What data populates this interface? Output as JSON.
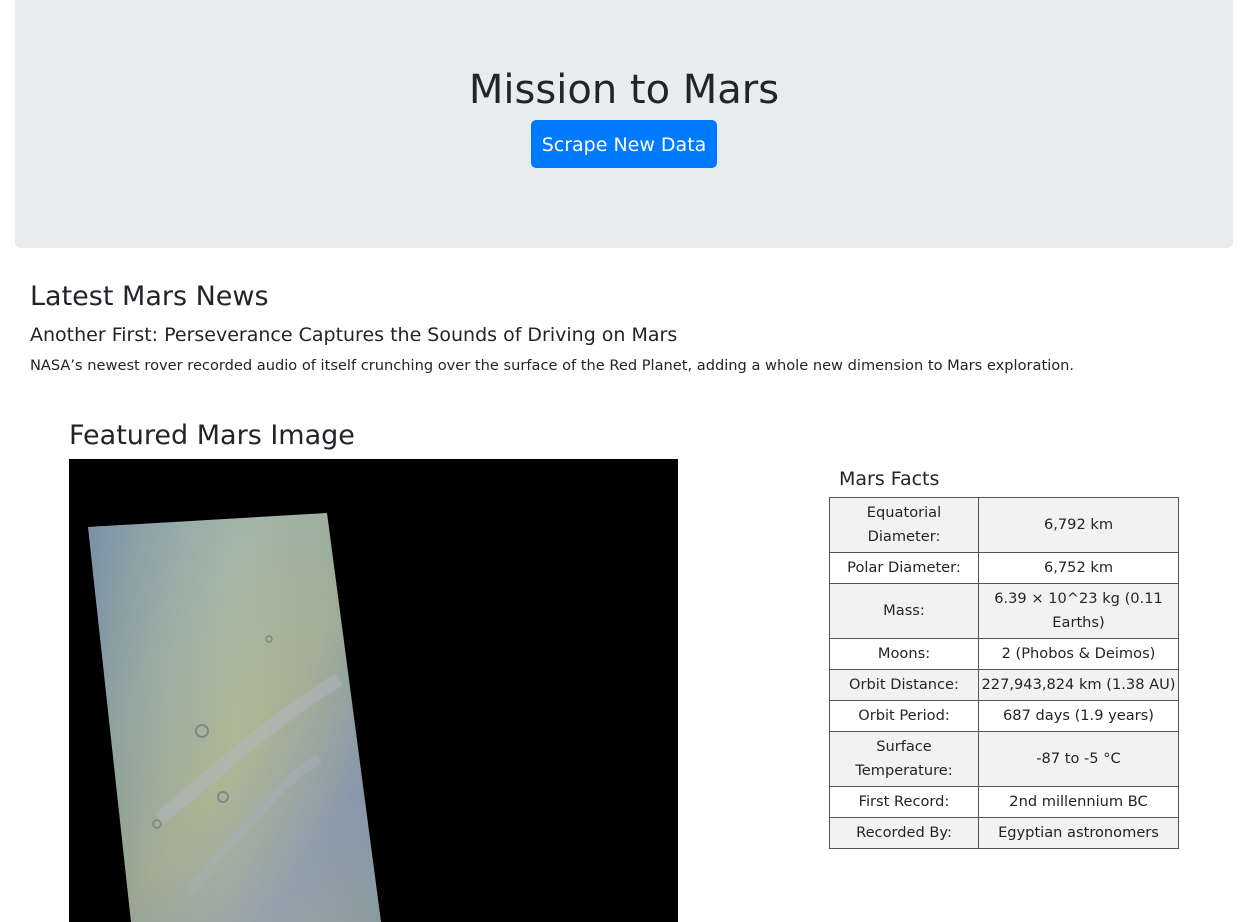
{
  "header": {
    "title": "Mission to Mars",
    "scrape_button": "Scrape New Data",
    "background_color": "#e9ecef",
    "button_color": "#007bff"
  },
  "news": {
    "heading": "Latest Mars News",
    "title": "Another First: Perseverance Captures the Sounds of Driving on Mars",
    "paragraph": "NASA’s newest rover recorded audio of itself crunching over the surface of the Red Planet, adding a whole new dimension to Mars exploration."
  },
  "featured_image": {
    "heading": "Featured Mars Image"
  },
  "facts": {
    "heading": "Mars Facts",
    "rows": [
      {
        "label": "Equatorial Diameter:",
        "value": "6,792 km"
      },
      {
        "label": "Polar Diameter:",
        "value": "6,752 km"
      },
      {
        "label": "Mass:",
        "value": "6.39 × 10^23 kg (0.11 Earths)"
      },
      {
        "label": "Moons:",
        "value": "2 (Phobos & Deimos)"
      },
      {
        "label": "Orbit Distance:",
        "value": "227,943,824 km (1.38 AU)"
      },
      {
        "label": "Orbit Period:",
        "value": "687 days (1.9 years)"
      },
      {
        "label": "Surface Temperature:",
        "value": "-87 to -5 °C"
      },
      {
        "label": "First Record:",
        "value": "2nd millennium BC"
      },
      {
        "label": "Recorded By:",
        "value": "Egyptian astronomers"
      }
    ]
  }
}
